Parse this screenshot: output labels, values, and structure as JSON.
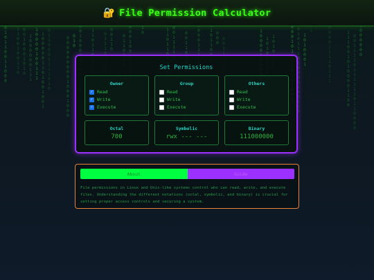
{
  "header": {
    "title": "File Permission Calculator",
    "icon": "lock-icon"
  },
  "panel": {
    "title": "Set Permissions",
    "groups": [
      {
        "title": "Owner",
        "options": [
          {
            "label": "Read",
            "checked": true
          },
          {
            "label": "Write",
            "checked": true
          },
          {
            "label": "Execute",
            "checked": true
          }
        ]
      },
      {
        "title": "Group",
        "options": [
          {
            "label": "Read",
            "checked": false
          },
          {
            "label": "Write",
            "checked": false
          },
          {
            "label": "Execute",
            "checked": false
          }
        ]
      },
      {
        "title": "Others",
        "options": [
          {
            "label": "Read",
            "checked": false
          },
          {
            "label": "Write",
            "checked": false
          },
          {
            "label": "Execute",
            "checked": false
          }
        ]
      }
    ],
    "results": [
      {
        "label": "Octal",
        "value": "700"
      },
      {
        "label": "Symbolic",
        "value": "rwx --- ---"
      },
      {
        "label": "Binary",
        "value": "111000000"
      }
    ]
  },
  "info": {
    "tabs": [
      "About",
      "Guide"
    ],
    "description": "File permissions in Linux and Unix-like systems control who can read, write, and execute files. Understanding the different notations (octal, symbolic, and binary) is crucial for setting proper access controls and securing a system."
  },
  "colors": {
    "accent_green": "#39ff14",
    "accent_purple": "#9b30ff",
    "accent_cyan": "#20d8c8",
    "accent_orange": "#e8833a"
  }
}
